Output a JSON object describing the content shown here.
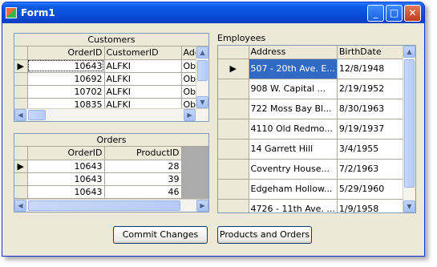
{
  "window": {
    "title": "Form1"
  },
  "customers": {
    "caption": "Customers",
    "columns": [
      "OrderID",
      "CustomerID",
      "Add"
    ],
    "rows": [
      [
        "10643",
        "ALFKI",
        "Ob"
      ],
      [
        "10692",
        "ALFKI",
        "Ob"
      ],
      [
        "10702",
        "ALFKI",
        "Ob"
      ],
      [
        "10835",
        "ALFKI",
        "Ob"
      ]
    ]
  },
  "orders": {
    "caption": "Orders",
    "columns": [
      "OrderID",
      "ProductID"
    ],
    "rows": [
      [
        "10643",
        "28"
      ],
      [
        "10643",
        "39"
      ],
      [
        "10643",
        "46"
      ]
    ]
  },
  "employees": {
    "label": "Employees",
    "columns": [
      "Address",
      "BirthDate"
    ],
    "rows": [
      [
        "507 - 20th Ave. E...",
        "12/8/1948"
      ],
      [
        "908 W. Capital ...",
        "2/19/1952"
      ],
      [
        "722 Moss Bay Bl...",
        "8/30/1963"
      ],
      [
        "4110 Old Redmo...",
        "9/19/1937"
      ],
      [
        "14 Garrett Hill",
        "3/4/1955"
      ],
      [
        "Coventry House...",
        "7/2/1963"
      ],
      [
        "Edgeham Hollow...",
        "5/29/1960"
      ],
      [
        "4726 - 11th Ave. ...",
        "1/9/1958"
      ]
    ]
  },
  "buttons": {
    "commit": "Commit Changes",
    "products_orders": "Products and Orders"
  },
  "icons": {
    "row_indicator": "▶",
    "up": "▲",
    "down": "▼",
    "left": "◀",
    "right": "▶"
  }
}
